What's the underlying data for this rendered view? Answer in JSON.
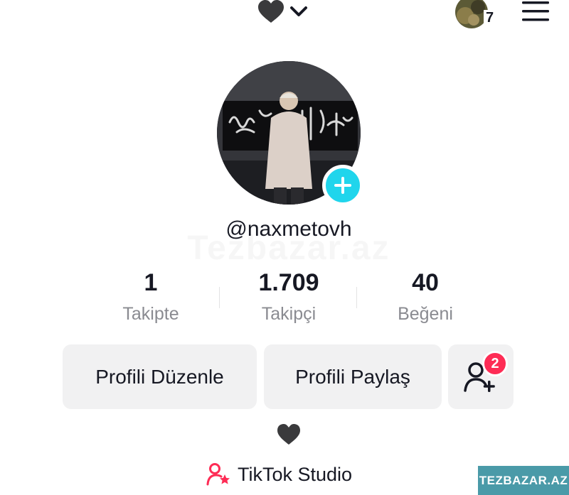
{
  "header": {
    "heart_emoji": "🖤",
    "account_switch_icon": "chevron-down-icon",
    "notification_count": "7",
    "menu_icon": "hamburger-menu-icon"
  },
  "profile": {
    "username": "@naxmetovh",
    "watermark": "Tezbazar.az"
  },
  "stats": [
    {
      "value": "1",
      "label": "Takipte"
    },
    {
      "value": "1.709",
      "label": "Takipçi"
    },
    {
      "value": "40",
      "label": "Beğeni"
    }
  ],
  "actions": {
    "edit_label": "Profili Düzenle",
    "share_label": "Profili Paylaş",
    "friend_request_count": "2"
  },
  "bio": {
    "emoji": "🖤"
  },
  "studio": {
    "label": "TikTok Studio"
  },
  "site_stamp": "TEZBAZAR.AZ",
  "colors": {
    "accent_cyan": "#20d5ec",
    "badge_red": "#fe2c55",
    "studio_pink": "#fe2c55",
    "button_gray": "#f1f1f2"
  }
}
